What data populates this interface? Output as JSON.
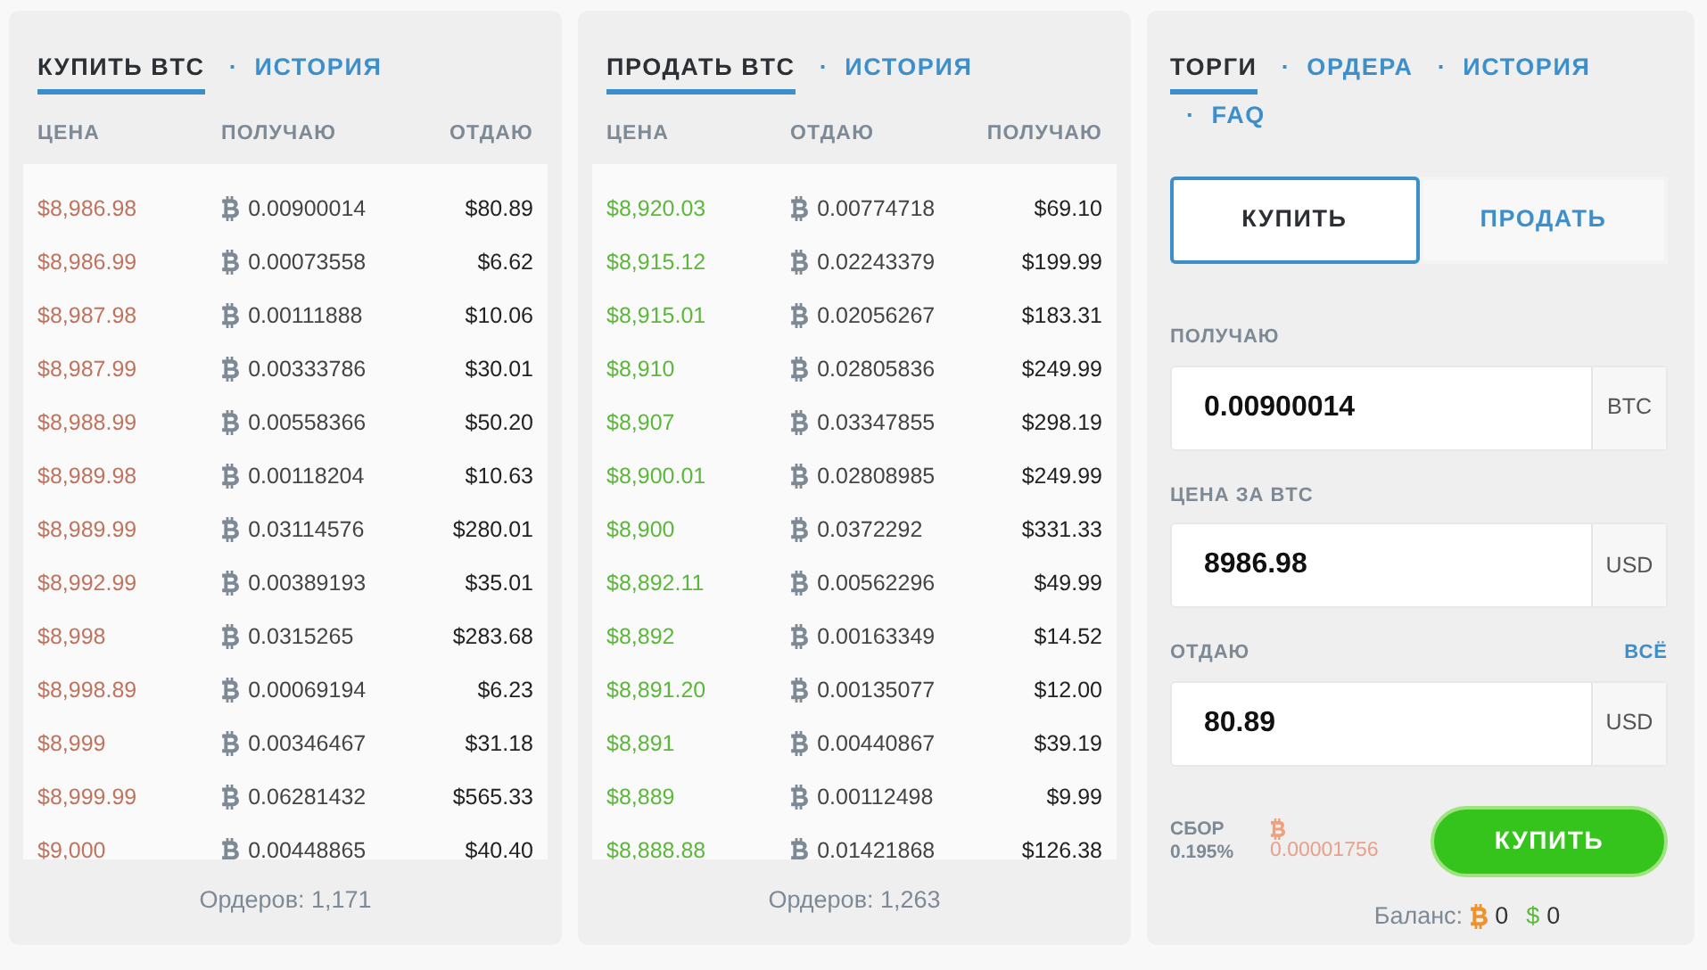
{
  "buy_panel": {
    "kind": "buy",
    "tabs": [
      {
        "label": "КУПИТЬ BTC",
        "selected": true
      },
      {
        "separator": "·",
        "label": "ИСТОРИЯ",
        "selected": false
      }
    ],
    "columns": [
      "ЦЕНА",
      "ПОЛУЧАЮ",
      "ОТДАЮ"
    ],
    "rows": [
      {
        "price": "$8,986.98",
        "btc": "0.00900014",
        "usd": "$80.89"
      },
      {
        "price": "$8,986.99",
        "btc": "0.00073558",
        "usd": "$6.62"
      },
      {
        "price": "$8,987.98",
        "btc": "0.00111888",
        "usd": "$10.06"
      },
      {
        "price": "$8,987.99",
        "btc": "0.00333786",
        "usd": "$30.01"
      },
      {
        "price": "$8,988.99",
        "btc": "0.00558366",
        "usd": "$50.20"
      },
      {
        "price": "$8,989.98",
        "btc": "0.00118204",
        "usd": "$10.63"
      },
      {
        "price": "$8,989.99",
        "btc": "0.03114576",
        "usd": "$280.01"
      },
      {
        "price": "$8,992.99",
        "btc": "0.00389193",
        "usd": "$35.01"
      },
      {
        "price": "$8,998",
        "btc": "0.0315265",
        "usd": "$283.68"
      },
      {
        "price": "$8,998.89",
        "btc": "0.00069194",
        "usd": "$6.23"
      },
      {
        "price": "$8,999",
        "btc": "0.00346467",
        "usd": "$31.18"
      },
      {
        "price": "$8,999.99",
        "btc": "0.06281432",
        "usd": "$565.33"
      },
      {
        "price": "$9,000",
        "btc": "0.00448865",
        "usd": "$40.40"
      }
    ],
    "footer": "Ордеров: 1,171"
  },
  "sell_panel": {
    "kind": "sell",
    "tabs": [
      {
        "label": "ПРОДАТЬ BTC",
        "selected": true
      },
      {
        "separator": "·",
        "label": "ИСТОРИЯ",
        "selected": false
      }
    ],
    "columns": [
      "ЦЕНА",
      "ОТДАЮ",
      "ПОЛУЧАЮ"
    ],
    "rows": [
      {
        "price": "$8,920.03",
        "btc": "0.00774718",
        "usd": "$69.10"
      },
      {
        "price": "$8,915.12",
        "btc": "0.02243379",
        "usd": "$199.99"
      },
      {
        "price": "$8,915.01",
        "btc": "0.02056267",
        "usd": "$183.31"
      },
      {
        "price": "$8,910",
        "btc": "0.02805836",
        "usd": "$249.99"
      },
      {
        "price": "$8,907",
        "btc": "0.03347855",
        "usd": "$298.19"
      },
      {
        "price": "$8,900.01",
        "btc": "0.02808985",
        "usd": "$249.99"
      },
      {
        "price": "$8,900",
        "btc": "0.0372292",
        "usd": "$331.33"
      },
      {
        "price": "$8,892.11",
        "btc": "0.00562296",
        "usd": "$49.99"
      },
      {
        "price": "$8,892",
        "btc": "0.00163349",
        "usd": "$14.52"
      },
      {
        "price": "$8,891.20",
        "btc": "0.00135077",
        "usd": "$12.00"
      },
      {
        "price": "$8,891",
        "btc": "0.00440867",
        "usd": "$39.19"
      },
      {
        "price": "$8,889",
        "btc": "0.00112498",
        "usd": "$9.99"
      },
      {
        "price": "$8,888.88",
        "btc": "0.01421868",
        "usd": "$126.38"
      }
    ],
    "footer": "Ордеров: 1,263"
  },
  "trade_panel": {
    "tabs": [
      {
        "label": "ТОРГИ",
        "selected": true
      },
      {
        "separator": "·",
        "label": "ОРДЕРА",
        "selected": false
      },
      {
        "separator": "·",
        "label": "ИСТОРИЯ",
        "selected": false
      },
      {
        "separator": "·",
        "label": "FAQ",
        "selected": false
      }
    ],
    "mode_buttons": [
      {
        "label": "КУПИТЬ",
        "selected": true
      },
      {
        "label": "ПРОДАТЬ",
        "selected": false
      }
    ],
    "fields": [
      {
        "label": "ПОЛУЧАЮ",
        "value": "0.00900014",
        "unit": "BTC"
      },
      {
        "label": "ЦЕНА ЗА BTC",
        "value": "8986.98",
        "unit": "USD"
      },
      {
        "label": "ОТДАЮ",
        "link": "ВСЁ",
        "value": "80.89",
        "unit": "USD"
      }
    ],
    "fee": {
      "label": "СБОР",
      "rate": "0.195%",
      "amount": "0.00001756"
    },
    "submit": "КУПИТЬ",
    "balance": {
      "label": "Баланс:",
      "btc": "0",
      "usd_symbol": "$",
      "usd": "0"
    }
  }
}
